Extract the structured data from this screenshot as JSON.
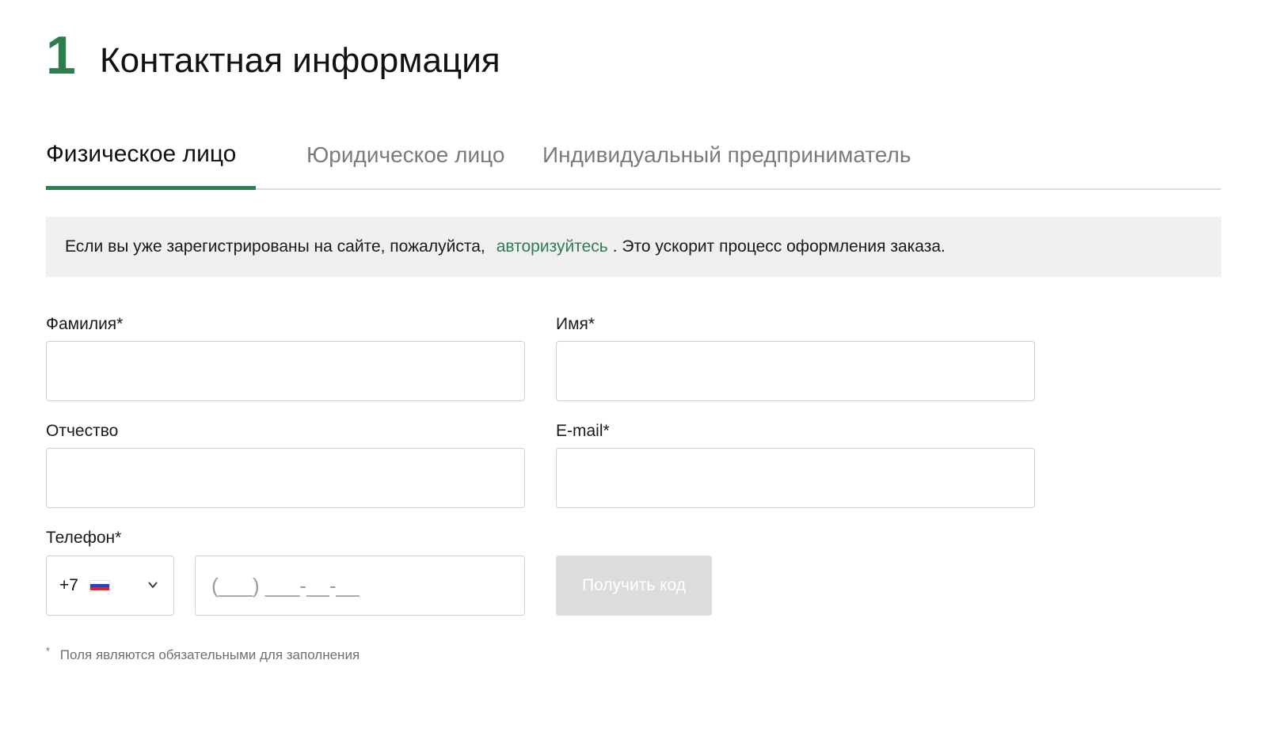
{
  "section": {
    "number": "1",
    "title": "Контактная информация"
  },
  "tabs": [
    {
      "label": "Физическое лицо",
      "active": true
    },
    {
      "label": "Юридическое лицо",
      "active": false
    },
    {
      "label": "Индивидуальный предприниматель",
      "active": false
    }
  ],
  "info": {
    "before": "Если вы уже зарегистрированы на сайте, пожалуйста,",
    "link": "авторизуйтесь",
    "after": ". Это ускорит процесс оформления заказа."
  },
  "form": {
    "last_name_label": "Фамилия*",
    "last_name_value": "",
    "first_name_label": "Имя*",
    "first_name_value": "",
    "middle_name_label": "Отчество",
    "middle_name_value": "",
    "email_label": "E-mail*",
    "email_value": "",
    "phone_label": "Телефон*",
    "country_code": "+7",
    "phone_placeholder": "(___) ___-__-__",
    "get_code_button": "Получить код"
  },
  "footnote": {
    "star": "*",
    "text": "Поля являются обязательными для заполнения"
  },
  "colors": {
    "accent": "#2e7d4f",
    "info_bg": "#efefef",
    "button_disabled": "#dcdcdc"
  }
}
